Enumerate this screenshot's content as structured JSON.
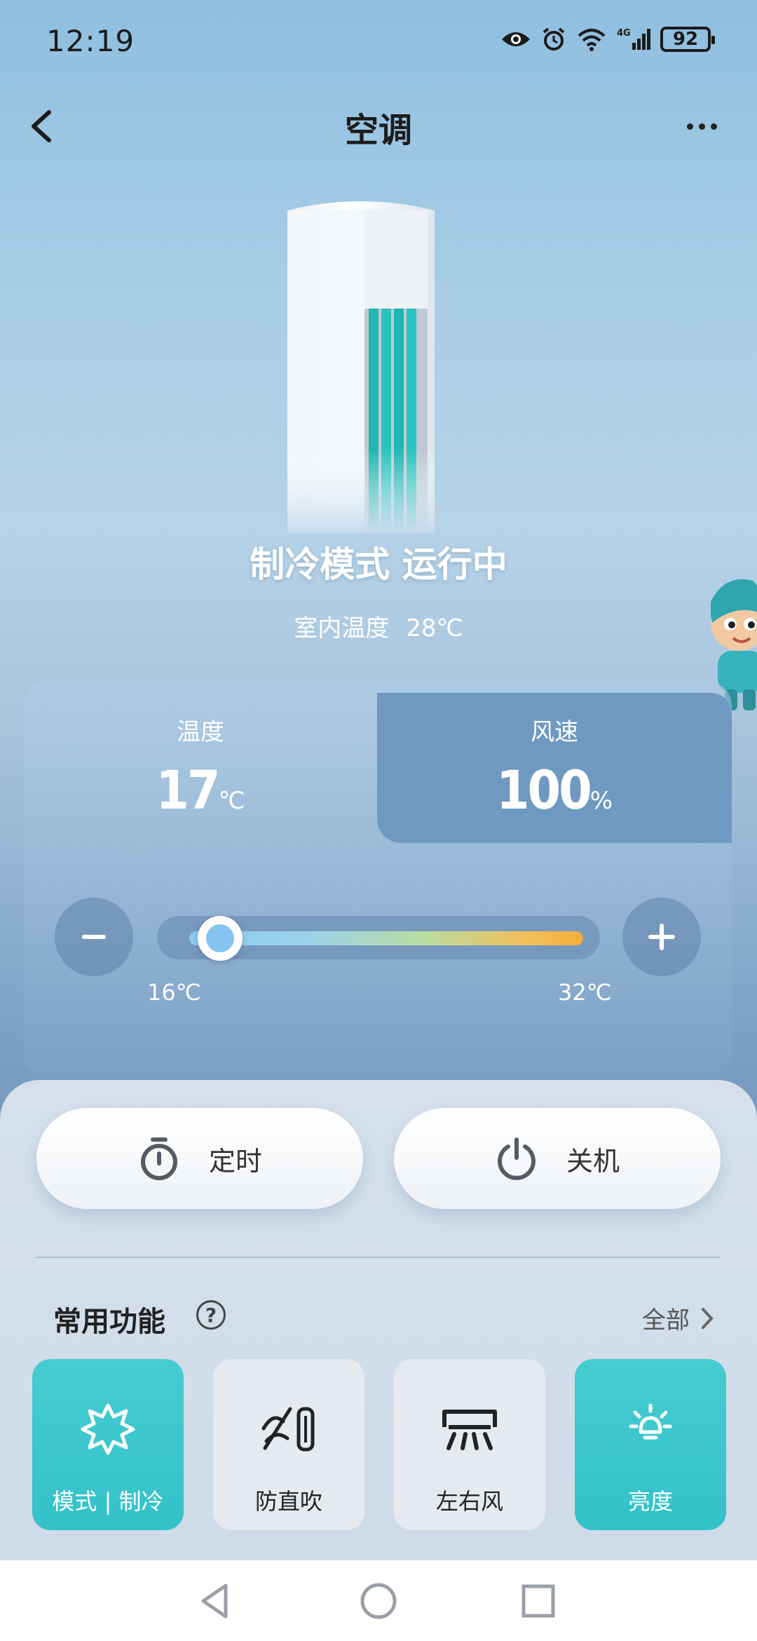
{
  "status_bar": {
    "time": "12:19",
    "battery": "92",
    "icons": [
      "eye-icon",
      "alarm-icon",
      "wifi-icon",
      "signal-4g-icon",
      "battery-icon"
    ]
  },
  "header": {
    "title": "空调"
  },
  "device": {
    "mode_status": "制冷模式 运行中",
    "indoor_label": "室内温度",
    "indoor_value": "28℃"
  },
  "controls": {
    "temperature": {
      "label": "温度",
      "value": "17",
      "unit": "℃"
    },
    "wind_speed": {
      "label": "风速",
      "value": "100",
      "unit": "%"
    },
    "slider": {
      "min_label": "16℃",
      "max_label": "32℃",
      "min": 16,
      "max": 32,
      "value": 17
    }
  },
  "actions": {
    "timer_label": "定时",
    "power_label": "关机"
  },
  "functions": {
    "section_title": "常用功能",
    "all_label": "全部",
    "items": [
      {
        "label": "模式 | 制冷",
        "icon": "snowflake-icon",
        "active": true
      },
      {
        "label": "防直吹",
        "icon": "anti-direct-wind-icon",
        "active": false
      },
      {
        "label": "左右风",
        "icon": "swing-wind-icon",
        "active": false
      },
      {
        "label": "亮度",
        "icon": "light-bulb-icon",
        "active": true
      }
    ]
  },
  "colors": {
    "accent_teal": "#33c2c8",
    "slider_start": "#8cc9f1",
    "slider_end": "#f5ae3a"
  }
}
